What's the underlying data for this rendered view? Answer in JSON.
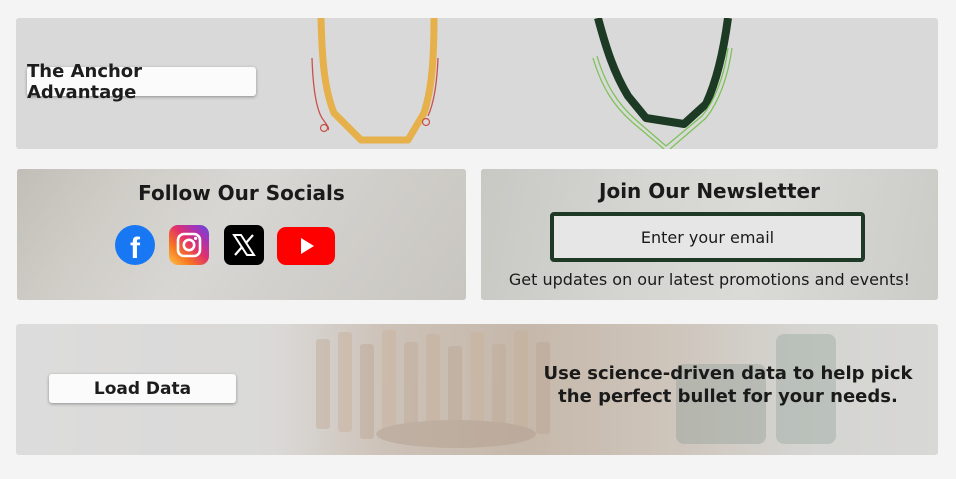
{
  "banner": {
    "button_label": "The Anchor Advantage",
    "colors": {
      "left_profile": "#e6b04a",
      "left_lines": "#c8504a",
      "right_profile": "#1c3a24",
      "right_lines": "#7ec25a"
    }
  },
  "socials": {
    "title": "Follow Our Socials",
    "icons": [
      {
        "name": "facebook-icon",
        "glyph": "f",
        "color": "#1877f2"
      },
      {
        "name": "instagram-icon",
        "color": "#e1306c"
      },
      {
        "name": "x-icon",
        "glyph": "𝕏",
        "color": "#000000"
      },
      {
        "name": "youtube-icon",
        "color": "#ff0000"
      }
    ]
  },
  "newsletter": {
    "title": "Join Our Newsletter",
    "email_placeholder": "Enter your email",
    "subtitle": "Get updates on our latest promotions and events!",
    "accent": "#1e3a26"
  },
  "load_data": {
    "button_label": "Load Data",
    "description": "Use science-driven data to help pick the perfect bullet for your needs."
  }
}
